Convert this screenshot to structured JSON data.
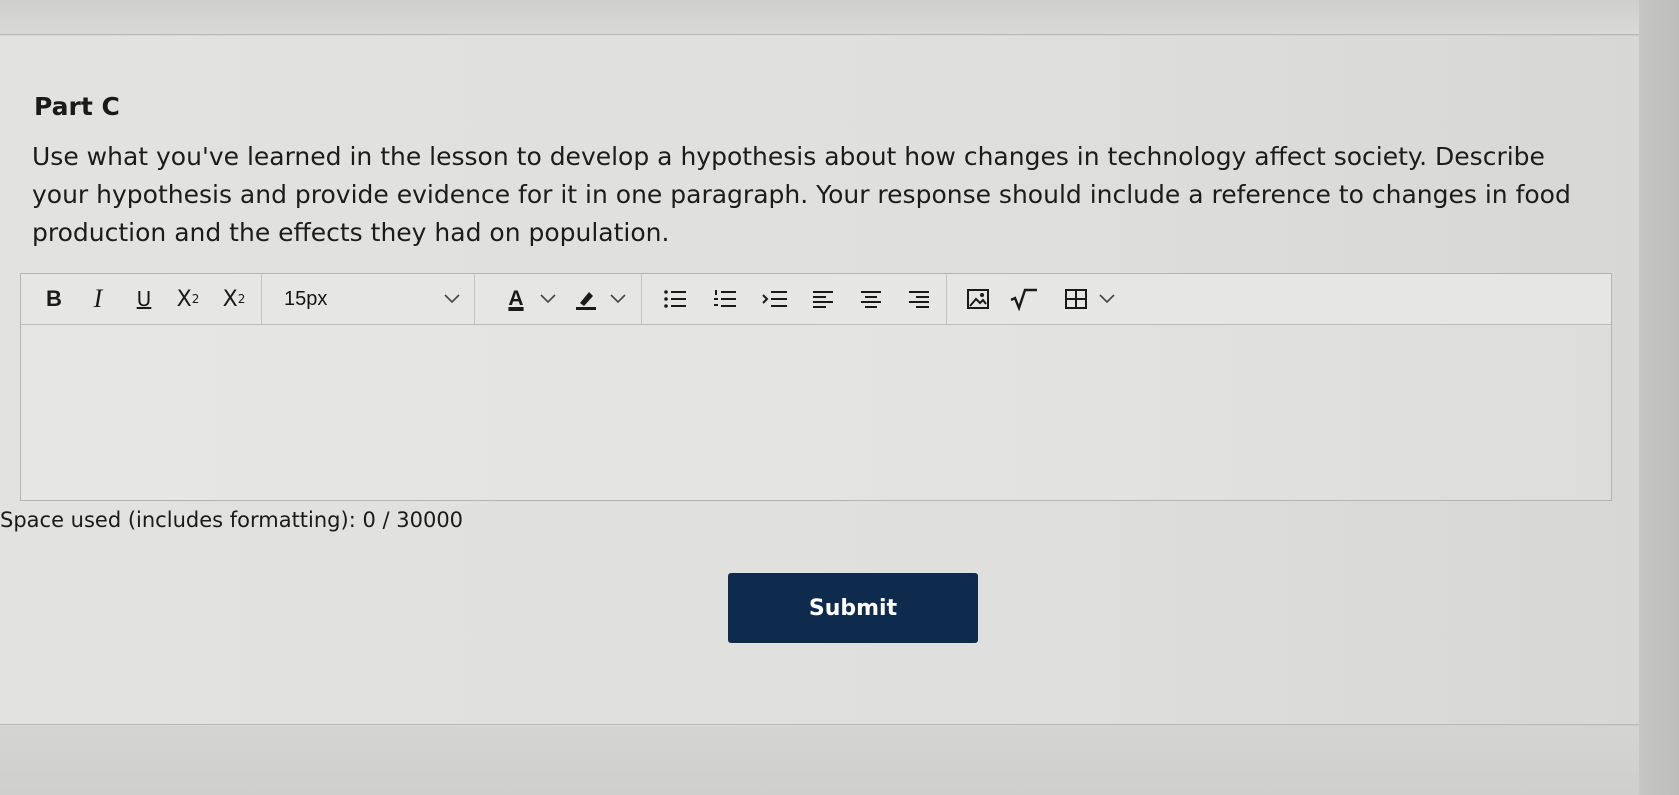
{
  "question": {
    "part_title": "Part C",
    "prompt": "Use what you've learned in the lesson to develop a hypothesis about how changes in technology affect society. Describe your hypothesis and provide evidence for it in one paragraph. Your response should include a reference to changes in food production and the effects they had on population."
  },
  "toolbar": {
    "bold": "B",
    "italic": "I",
    "underline": "U",
    "superscript_base": "X",
    "superscript_mark": "2",
    "subscript_base": "X",
    "subscript_mark": "2",
    "font_size": "15px",
    "font_color_label": "A",
    "icons": {
      "highlight": "highlighter-icon",
      "bullet_list": "bullet-list-icon",
      "numbered_list": "numbered-list-icon",
      "indent": "indent-icon",
      "align_left": "align-left-icon",
      "align_center": "align-center-icon",
      "align_right": "align-right-icon",
      "image": "image-icon",
      "equation": "square-root-icon",
      "table": "table-icon"
    }
  },
  "editor": {
    "value": ""
  },
  "counter": {
    "text": "Space used (includes formatting): 0 / 30000"
  },
  "submit": {
    "label": "Submit"
  },
  "colors": {
    "submit_bg": "#0e2a4d",
    "page_bg": "#dcdcda"
  }
}
